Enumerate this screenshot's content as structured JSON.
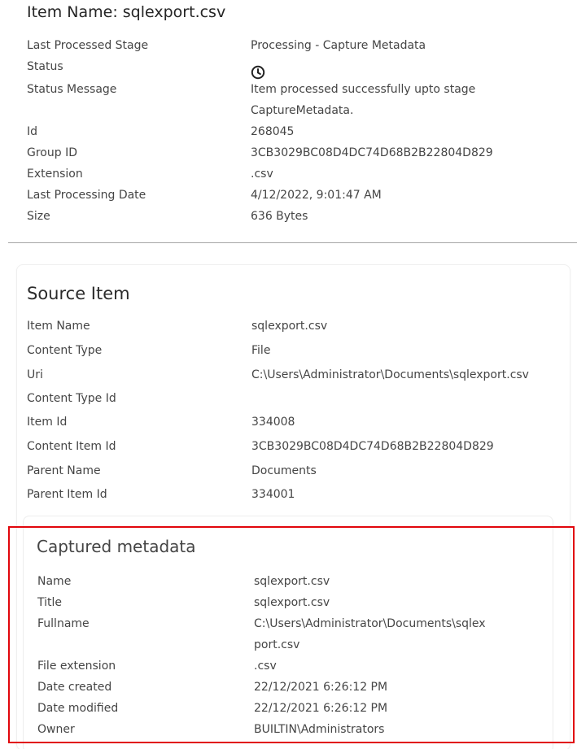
{
  "header": {
    "title": "Item Name: sqlexport.csv"
  },
  "item_details": [
    {
      "label": "Last Processed Stage",
      "value": "Processing - Capture Metadata"
    },
    {
      "label": "Status",
      "value": "",
      "icon": "clock-icon"
    },
    {
      "label": "Status Message",
      "value_line1": "Item processed successfully upto stage",
      "value_line2": "CaptureMetadata."
    },
    {
      "label": "Id",
      "value": "268045"
    },
    {
      "label": "Group ID",
      "value": "3CB3029BC08D4DC74D68B2B22804D829"
    },
    {
      "label": "Extension",
      "value": ".csv"
    },
    {
      "label": "Last Processing Date",
      "value": "4/12/2022, 9:01:47 AM"
    },
    {
      "label": "Size",
      "value": "636 Bytes"
    }
  ],
  "source_item": {
    "title": "Source Item",
    "rows": [
      {
        "label": "Item Name",
        "value": "sqlexport.csv"
      },
      {
        "label": "Content Type",
        "value": "File"
      },
      {
        "label": "Uri",
        "value": "C:\\Users\\Administrator\\Documents\\sqlexport.csv"
      },
      {
        "label": "Content Type Id",
        "value": ""
      },
      {
        "label": "Item Id",
        "value": "334008"
      },
      {
        "label": "Content Item Id",
        "value": "3CB3029BC08D4DC74D68B2B22804D829"
      },
      {
        "label": "Parent Name",
        "value": "Documents"
      },
      {
        "label": "Parent Item Id",
        "value": "334001"
      }
    ]
  },
  "captured_metadata": {
    "title": "Captured metadata",
    "rows": [
      {
        "label": "Name",
        "value": "sqlexport.csv"
      },
      {
        "label": "Title",
        "value": "sqlexport.csv"
      },
      {
        "label": "Fullname",
        "value_line1": "C:\\Users\\Administrator\\Documents\\sqlex",
        "value_line2": "port.csv"
      },
      {
        "label": "File extension",
        "value": ".csv"
      },
      {
        "label": "Date created",
        "value": "22/12/2021 6:26:12 PM"
      },
      {
        "label": "Date modified",
        "value": "22/12/2021 6:26:12 PM"
      },
      {
        "label": "Owner",
        "value": "BUILTIN\\Administrators"
      }
    ]
  },
  "colors": {
    "highlight_border": "#e1060c",
    "divider": "#a6a6a6"
  }
}
